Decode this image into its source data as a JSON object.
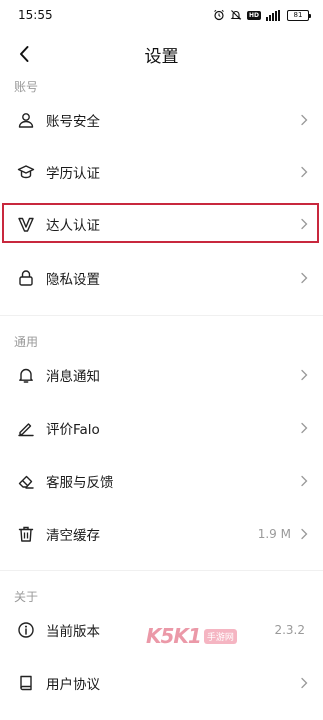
{
  "status_bar": {
    "time": "15:55",
    "battery": "81"
  },
  "header": {
    "title": "设置"
  },
  "sections": {
    "account": {
      "title": "账号"
    },
    "general": {
      "title": "通用"
    },
    "about": {
      "title": "关于"
    }
  },
  "items": {
    "account_security": {
      "label": "账号安全",
      "icon": "user-icon"
    },
    "education": {
      "label": "学历认证",
      "icon": "graduation-cap-icon"
    },
    "expert": {
      "label": "达人认证",
      "icon": "v-badge-icon"
    },
    "privacy": {
      "label": "隐私设置",
      "icon": "lock-icon"
    },
    "notifications": {
      "label": "消息通知",
      "icon": "bell-icon"
    },
    "rate": {
      "label": "评价Falo",
      "icon": "pen-icon"
    },
    "support": {
      "label": "客服与反馈",
      "icon": "eraser-icon"
    },
    "cache": {
      "label": "清空缓存",
      "value": "1.9 M",
      "icon": "trash-icon"
    },
    "version": {
      "label": "当前版本",
      "value": "2.3.2",
      "icon": "info-icon"
    },
    "agreement": {
      "label": "用户协议",
      "icon": "book-icon"
    }
  },
  "watermark": {
    "logo": "K5K1",
    "badge": "手游网"
  },
  "colors": {
    "highlight": "#c8283d",
    "section_text": "#9a9a9a"
  }
}
